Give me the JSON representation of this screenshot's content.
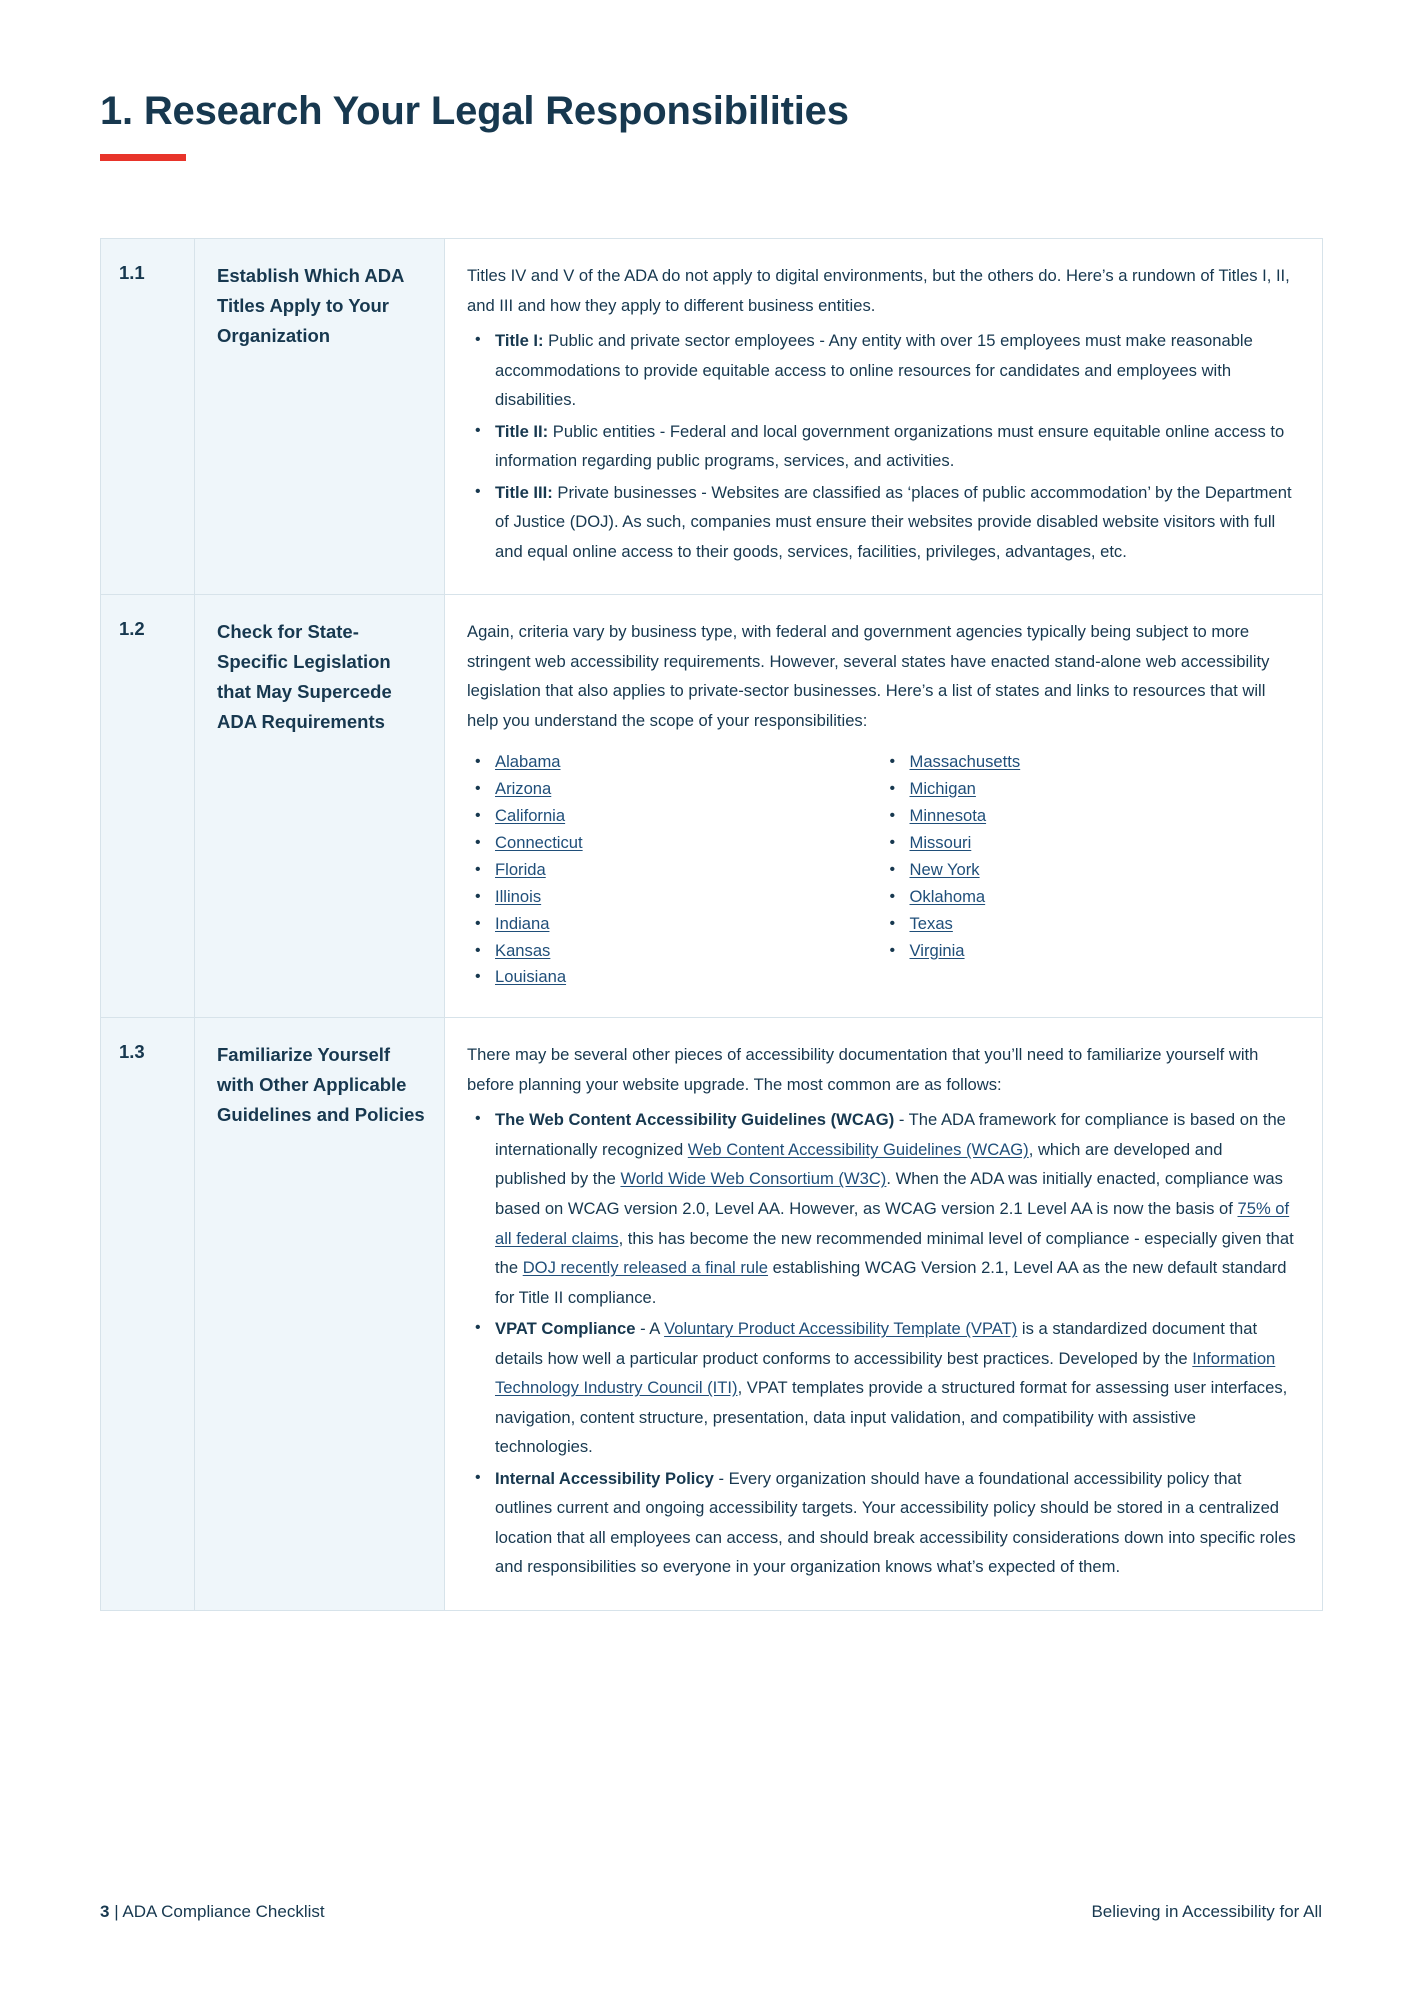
{
  "page": {
    "title": "1. Research Your Legal Responsibilities",
    "accent_color": "#e8342a",
    "heading_color": "#17384f",
    "link_color": "#1f4e79",
    "cell_label_bg": "#eff6fa"
  },
  "rows": [
    {
      "number": "1.1",
      "label": "Establish Which ADA Titles Apply to Your Organization",
      "intro": "Titles IV and V of the ADA do not apply to digital environments, but the others do. Here’s a rundown of Titles I, II, and III and how they apply to different business entities.",
      "bullets": [
        {
          "lead": "Title I:",
          "text": " Public and private sector employees - Any entity with over 15 employees must make reasonable accommodations to provide equitable access to online resources for candidates and employees with disabilities."
        },
        {
          "lead": "Title II:",
          "text": " Public entities - Federal and local government organizations must ensure equitable online access to information regarding public programs, services, and activities."
        },
        {
          "lead": "Title III:",
          "text": " Private businesses - Websites are classified as ‘places of public accommodation’ by the Department of Justice (DOJ). As such, companies must ensure their websites provide disabled website visitors with full and equal online access to their goods, services, facilities, privileges, advantages, etc."
        }
      ]
    },
    {
      "number": "1.2",
      "label": "Check for State-Specific Legislation that May Supercede ADA Requirements",
      "intro": "Again, criteria vary by business type, with federal and government agencies typically being subject to more stringent web accessibility requirements. However, several states have enacted stand-alone web accessibility legislation that also applies to private-sector businesses. Here’s a list of states and links to resources that will help you understand the scope of your responsibilities:",
      "states_left": [
        "Alabama",
        "Arizona",
        "California",
        "Connecticut",
        "Florida",
        "Illinois",
        "Indiana",
        "Kansas",
        "Louisiana"
      ],
      "states_right": [
        "Massachusetts",
        "Michigan",
        "Minnesota",
        "Missouri",
        "New York",
        "Oklahoma",
        "Texas",
        "Virginia"
      ]
    },
    {
      "number": "1.3",
      "label": "Familiarize Yourself with Other Applicable Guidelines and Policies",
      "intro": "There may be several other pieces of accessibility documentation that you’ll need to familiarize yourself with before planning your website upgrade. The most common are as follows:",
      "bullets": [
        {
          "lead": "The Web Content Accessibility Guidelines (WCAG)",
          "parts": [
            {
              "type": "text",
              "value": " - The ADA framework for compliance is based on the internationally recognized "
            },
            {
              "type": "link",
              "value": "Web Content Accessibility Guidelines (WCAG)"
            },
            {
              "type": "text",
              "value": ", which are developed and published by the "
            },
            {
              "type": "link",
              "value": "World Wide Web Consortium (W3C)"
            },
            {
              "type": "text",
              "value": ". When the ADA was initially enacted, compliance was based on WCAG version 2.0, Level AA. However, as WCAG version 2.1 Level AA is now the basis of "
            },
            {
              "type": "link",
              "value": "75% of all federal claims"
            },
            {
              "type": "text",
              "value": ", this has become the new recommended minimal level of compliance - especially given that the "
            },
            {
              "type": "link",
              "value": "DOJ recently released a final rule"
            },
            {
              "type": "text",
              "value": " establishing WCAG Version 2.1, Level AA as the new default standard for Title II compliance."
            }
          ]
        },
        {
          "lead": "VPAT Compliance",
          "parts": [
            {
              "type": "text",
              "value": " - A "
            },
            {
              "type": "link",
              "value": "Voluntary Product Accessibility Template (VPAT)"
            },
            {
              "type": "text",
              "value": " is a standardized document that details how well a particular product conforms to accessibility best practices. Developed by the "
            },
            {
              "type": "link",
              "value": "Information Technology Industry Council (ITI)"
            },
            {
              "type": "text",
              "value": ", VPAT templates provide a structured format for assessing user interfaces, navigation, content structure, presentation, data input validation, and compatibility with assistive technologies."
            }
          ]
        },
        {
          "lead": "Internal Accessibility Policy",
          "parts": [
            {
              "type": "text",
              "value": " - Every organization should have a foundational accessibility policy that outlines current and ongoing accessibility targets. Your accessibility policy should be stored in a centralized location that all employees can access, and should break accessibility considerations down into specific roles and responsibilities so everyone in your organization knows what’s expected of them."
            }
          ]
        }
      ]
    }
  ],
  "footer": {
    "page_number": "3",
    "separator": " | ",
    "document_name": "ADA Compliance Checklist",
    "tagline": "Believing in Accessibility for All"
  }
}
